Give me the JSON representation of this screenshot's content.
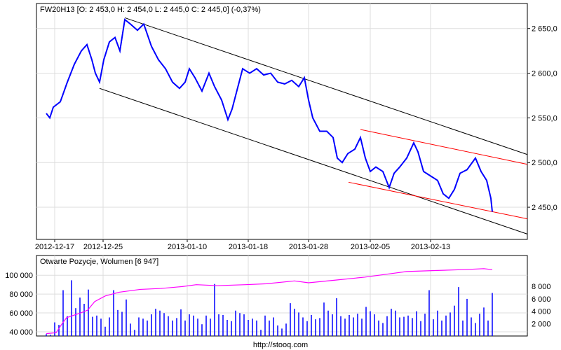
{
  "chart_data": [
    {
      "type": "line",
      "title": "FW20H13 [O: 2 453,0  H: 2 454,0  L: 2 445,0  C: 2 445,0] (-0,37%)",
      "x_unit": "bar index",
      "xlim": [
        -14,
        686
      ],
      "ylim": [
        2414,
        2678
      ],
      "y_ticks": [
        {
          "v": 2450,
          "label": "2 450,0"
        },
        {
          "v": 2500,
          "label": "2 500,0"
        },
        {
          "v": 2550,
          "label": "2 550,0"
        },
        {
          "v": 2600,
          "label": "2 600,0"
        },
        {
          "v": 2650,
          "label": "2 650,0"
        }
      ],
      "x_ticks": [
        {
          "x": 12,
          "label": "2012-12-17"
        },
        {
          "x": 81,
          "label": "2012-12-25"
        },
        {
          "x": 201,
          "label": "2013-01-10"
        },
        {
          "x": 288,
          "label": "2013-01-18"
        },
        {
          "x": 374,
          "label": "2013-01-28"
        },
        {
          "x": 462,
          "label": "2013-02-05"
        },
        {
          "x": 548,
          "label": "2013-02-13"
        }
      ],
      "series": [
        {
          "name": "FW20H13",
          "color": "#0000ff",
          "points": [
            [
              0,
              2555
            ],
            [
              5,
              2550
            ],
            [
              10,
              2562
            ],
            [
              20,
              2568
            ],
            [
              30,
              2590
            ],
            [
              40,
              2610
            ],
            [
              50,
              2625
            ],
            [
              58,
              2632
            ],
            [
              65,
              2615
            ],
            [
              70,
              2600
            ],
            [
              76,
              2590
            ],
            [
              82,
              2615
            ],
            [
              90,
              2635
            ],
            [
              98,
              2640
            ],
            [
              105,
              2625
            ],
            [
              112,
              2660
            ],
            [
              120,
              2655
            ],
            [
              130,
              2648
            ],
            [
              139,
              2655
            ],
            [
              150,
              2630
            ],
            [
              160,
              2615
            ],
            [
              170,
              2605
            ],
            [
              180,
              2590
            ],
            [
              190,
              2583
            ],
            [
              198,
              2590
            ],
            [
              204,
              2605
            ],
            [
              212,
              2595
            ],
            [
              222,
              2580
            ],
            [
              232,
              2600
            ],
            [
              240,
              2585
            ],
            [
              250,
              2570
            ],
            [
              259,
              2548
            ],
            [
              265,
              2560
            ],
            [
              275,
              2590
            ],
            [
              280,
              2605
            ],
            [
              290,
              2600
            ],
            [
              300,
              2605
            ],
            [
              310,
              2598
            ],
            [
              320,
              2600
            ],
            [
              330,
              2590
            ],
            [
              340,
              2588
            ],
            [
              350,
              2592
            ],
            [
              360,
              2585
            ],
            [
              368,
              2595
            ],
            [
              374,
              2570
            ],
            [
              380,
              2550
            ],
            [
              390,
              2535
            ],
            [
              400,
              2535
            ],
            [
              409,
              2528
            ],
            [
              415,
              2505
            ],
            [
              422,
              2500
            ],
            [
              430,
              2510
            ],
            [
              440,
              2515
            ],
            [
              448,
              2528
            ],
            [
              455,
              2505
            ],
            [
              462,
              2490
            ],
            [
              470,
              2495
            ],
            [
              480,
              2490
            ],
            [
              489,
              2472
            ],
            [
              496,
              2488
            ],
            [
              504,
              2495
            ],
            [
              514,
              2505
            ],
            [
              524,
              2522
            ],
            [
              530,
              2512
            ],
            [
              538,
              2490
            ],
            [
              548,
              2485
            ],
            [
              558,
              2480
            ],
            [
              566,
              2465
            ],
            [
              574,
              2460
            ],
            [
              582,
              2470
            ],
            [
              590,
              2488
            ],
            [
              600,
              2492
            ],
            [
              612,
              2505
            ],
            [
              620,
              2490
            ],
            [
              628,
              2480
            ],
            [
              634,
              2460
            ],
            [
              636,
              2445
            ]
          ]
        }
      ],
      "trend_lines": [
        {
          "color": "#000000",
          "from": [
            112,
            2662
          ],
          "to": [
            686,
            2509
          ]
        },
        {
          "color": "#000000",
          "from": [
            76,
            2583
          ],
          "to": [
            686,
            2420
          ]
        },
        {
          "color": "#ff0000",
          "from": [
            448,
            2537
          ],
          "to": [
            686,
            2498
          ]
        },
        {
          "color": "#ff0000",
          "from": [
            431,
            2478
          ],
          "to": [
            686,
            2437
          ]
        }
      ]
    },
    {
      "type": "bar",
      "title": "Otwarte Pozycje, Wolumen [6 947]",
      "left_ticks": [
        {
          "v": 40000,
          "label": "40 000"
        },
        {
          "v": 60000,
          "label": "60 000"
        },
        {
          "v": 80000,
          "label": "80 000"
        },
        {
          "v": 100000,
          "label": "100 000"
        }
      ],
      "right_ticks": [
        {
          "v": 2000,
          "label": "2 000"
        },
        {
          "v": 4000,
          "label": "4 000"
        },
        {
          "v": 6000,
          "label": "6 000"
        },
        {
          "v": 8000,
          "label": "8 000"
        }
      ],
      "volume_color": "#0000ff",
      "oi_color": "#ff00ff",
      "volume": [
        300,
        200,
        2200,
        1800,
        7400,
        3200,
        9000,
        4500,
        6200,
        5200,
        7500,
        3100,
        3300,
        2800,
        1500,
        3000,
        7400,
        4200,
        3900,
        5900,
        2000,
        1000,
        3000,
        2800,
        2500,
        3500,
        4400,
        4100,
        3700,
        3200,
        2500,
        2900,
        4300,
        2500,
        3500,
        3300,
        2800,
        1900,
        3300,
        2800,
        8400,
        3500,
        3400,
        2600,
        2400,
        4100,
        3700,
        3500,
        2600,
        2800,
        2500,
        1000,
        3300,
        2500,
        3000,
        1700,
        1200,
        2000,
        5300,
        4400,
        3800,
        3000,
        2400,
        3400,
        2700,
        2900,
        5400,
        4100,
        3500,
        6100,
        3200,
        2800,
        3400,
        3000,
        3600,
        2800,
        4700,
        4000,
        3500,
        2500,
        2100,
        3200,
        4400,
        4100,
        3000,
        3100,
        3300,
        2900,
        4000,
        2400,
        3600,
        7400,
        2700,
        4100,
        2500,
        3300,
        3800,
        4900,
        7900,
        2500,
        6000,
        3000,
        2100,
        3600,
        4600,
        2500,
        6947
      ],
      "open_interest": [
        [
          0,
          38000
        ],
        [
          14,
          39000
        ],
        [
          22,
          48000
        ],
        [
          29,
          55000
        ],
        [
          49,
          60000
        ],
        [
          59,
          63000
        ],
        [
          69,
          72000
        ],
        [
          84,
          78000
        ],
        [
          104,
          82000
        ],
        [
          134,
          85000
        ],
        [
          164,
          86000
        ],
        [
          194,
          88000
        ],
        [
          214,
          90000
        ],
        [
          244,
          89000
        ],
        [
          284,
          90000
        ],
        [
          314,
          91000
        ],
        [
          354,
          94000
        ],
        [
          374,
          92000
        ],
        [
          414,
          95000
        ],
        [
          454,
          98000
        ],
        [
          494,
          102000
        ],
        [
          514,
          104000
        ],
        [
          554,
          105000
        ],
        [
          594,
          106000
        ],
        [
          624,
          107000
        ],
        [
          636,
          106000
        ]
      ],
      "oi_range": [
        35500,
        121000
      ],
      "vol_range": [
        0,
        13000
      ]
    }
  ],
  "footer": "http://stooq.com"
}
